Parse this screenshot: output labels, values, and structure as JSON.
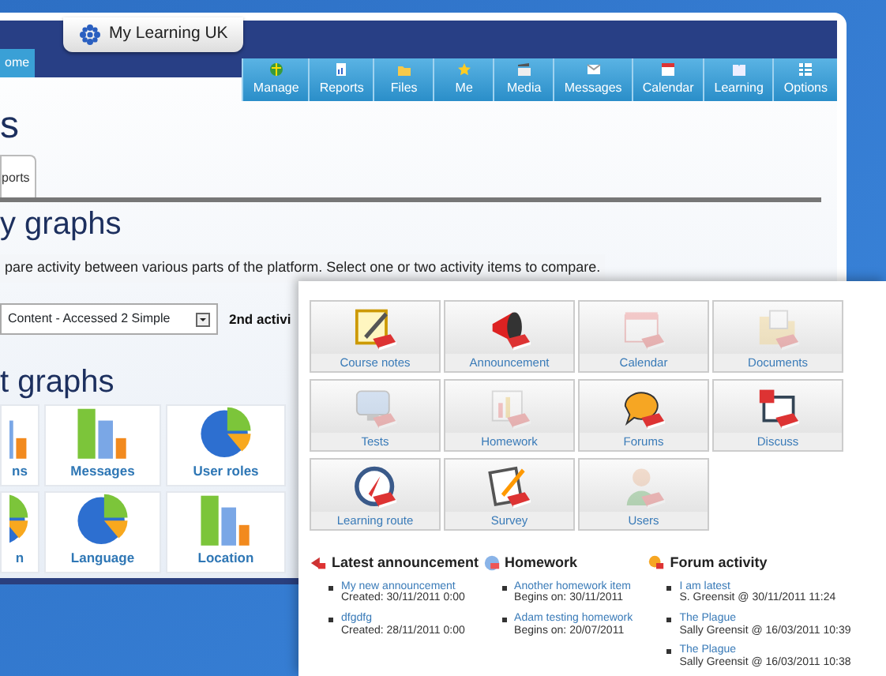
{
  "back_window": {
    "logo": "My Learning UK",
    "home_tab": "ome",
    "nav": [
      {
        "label": "Manage"
      },
      {
        "label": "Reports"
      },
      {
        "label": "Files"
      },
      {
        "label": "Me"
      },
      {
        "label": "Media"
      },
      {
        "label": "Messages"
      },
      {
        "label": "Calendar"
      },
      {
        "label": "Learning"
      },
      {
        "label": "Options"
      }
    ],
    "page_title": "s",
    "tabs": [
      {
        "label": "ports",
        "selected": true
      }
    ],
    "heading": "y graphs",
    "description": "pare activity between various parts of the platform. Select one or two activity items to compare.",
    "first_select": "Content - Accessed 2 Simple",
    "second_label": "2nd activi",
    "section_heading": "t graphs",
    "graph_tiles": [
      {
        "label": "ns",
        "kind": "bar"
      },
      {
        "label": "Messages",
        "kind": "bar"
      },
      {
        "label": "User roles",
        "kind": "pie"
      },
      {
        "label": "n",
        "kind": "pie"
      },
      {
        "label": "Language",
        "kind": "pie"
      },
      {
        "label": "Location",
        "kind": "bar"
      }
    ]
  },
  "front_panel": {
    "tools": [
      {
        "label": "Course notes",
        "enabled": true
      },
      {
        "label": "Announcement",
        "enabled": true
      },
      {
        "label": "Calendar",
        "enabled": false
      },
      {
        "label": "Documents",
        "enabled": false
      },
      {
        "label": "Tests",
        "enabled": false
      },
      {
        "label": "Homework",
        "enabled": false
      },
      {
        "label": "Forums",
        "enabled": true
      },
      {
        "label": "Discuss",
        "enabled": true
      },
      {
        "label": "Learning route",
        "enabled": true
      },
      {
        "label": "Survey",
        "enabled": true
      },
      {
        "label": "Users",
        "enabled": false
      }
    ],
    "feeds": [
      {
        "title": "Latest announcement",
        "items": [
          {
            "link": "My new announcement",
            "detail": "Created: 30/11/2011 0:00"
          },
          {
            "link": "dfgdfg",
            "detail": "Created: 28/11/2011 0:00"
          }
        ]
      },
      {
        "title": "Homework",
        "items": [
          {
            "link": "Another homework item",
            "detail": "Begins on: 30/11/2011"
          },
          {
            "link": "Adam testing homework",
            "detail": "Begins on: 20/07/2011"
          }
        ]
      },
      {
        "title": "Forum activity",
        "items": [
          {
            "link": "I am latest",
            "detail": "S. Greensit @ 30/11/2011 11:24"
          },
          {
            "link": "The Plague",
            "detail": "Sally Greensit @ 16/03/2011 10:39"
          },
          {
            "link": "The Plague",
            "detail": "Sally Greensit @ 16/03/2011 10:38"
          }
        ]
      }
    ]
  }
}
